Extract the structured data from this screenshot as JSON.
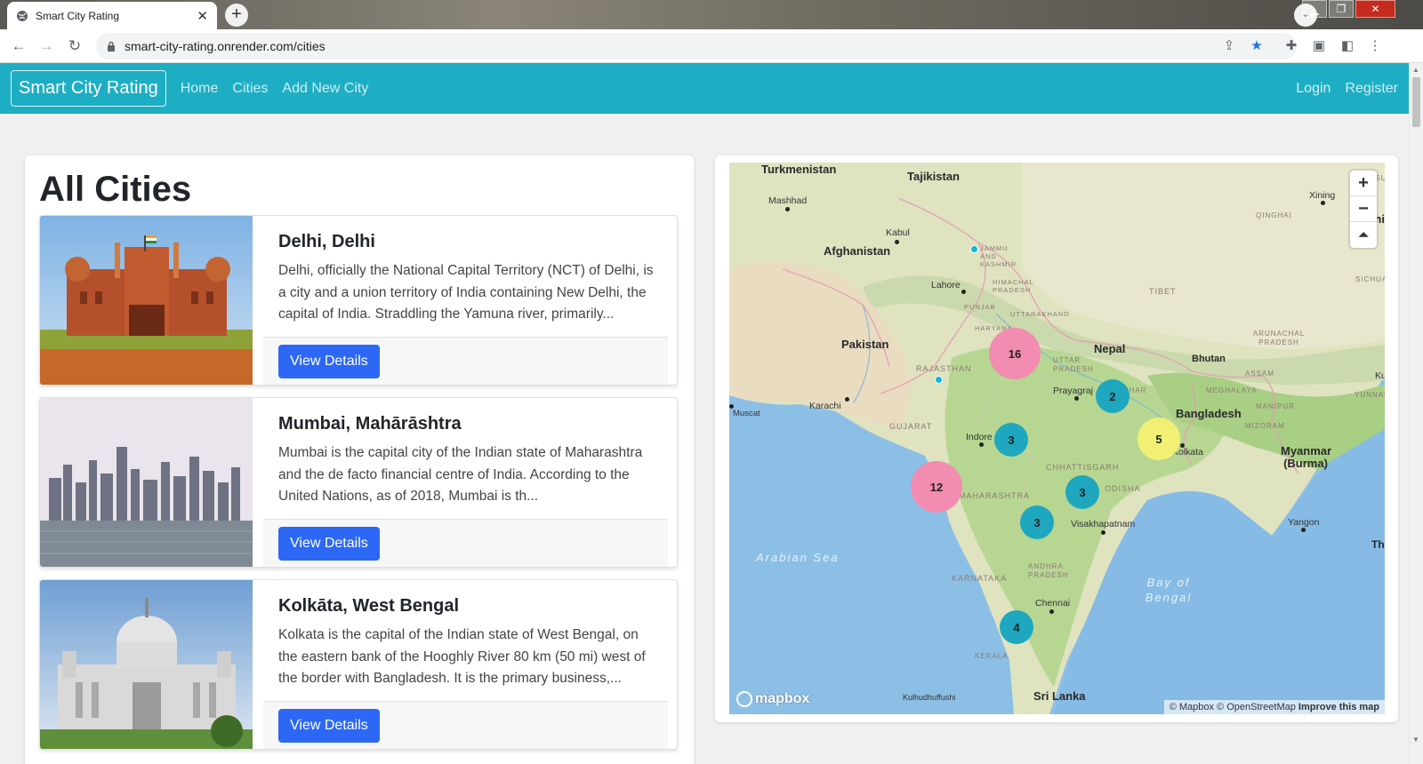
{
  "browser": {
    "tab_title": "Smart City Rating",
    "url": "smart-city-rating.onrender.com/cities"
  },
  "navbar": {
    "brand": "Smart City Rating",
    "links": [
      "Home",
      "Cities",
      "Add New City"
    ],
    "login": "Login",
    "register": "Register",
    "bg_color": "#1eaec4"
  },
  "page": {
    "title": "All Cities"
  },
  "cities": [
    {
      "title": "Delhi, Delhi",
      "description": "Delhi, officially the National Capital Territory (NCT) of Delhi, is a city and a union territory of India containing New Delhi, the capital of India. Straddling the Yamuna river, primarily...",
      "button": "View Details"
    },
    {
      "title": "Mumbai, Mahārāshtra",
      "description": "Mumbai is the capital city of the Indian state of Maharashtra and the de facto financial centre of India. According to the United Nations, as of 2018, Mumbai is th...",
      "button": "View Details"
    },
    {
      "title": "Kolkāta, West Bengal",
      "description": "Kolkata is the capital of the Indian state of West Bengal, on the eastern bank of the Hooghly River 80 km (50 mi) west of the border with Bangladesh. It is the primary business,...",
      "button": "View Details"
    }
  ],
  "map": {
    "countries": [
      "Turkmenistan",
      "Tajikistan",
      "Afghanistan",
      "Pakistan",
      "Nepal",
      "Bhutan",
      "Bangladesh",
      "Myanmar (Burma)",
      "Sri Lanka",
      "Chin",
      "Thai",
      "Ku"
    ],
    "states": [
      "JAMMU AND KASHMIR",
      "HIMACHAL PRADESH",
      "PUNJAB",
      "UTTARAKHAND",
      "HARYANA",
      "RAJASTHAN",
      "UTTAR PRADESH",
      "BIHAR",
      "GUJARAT",
      "MAHARASHTRA",
      "CHHATTISGARH",
      "ODISHA",
      "KARNATAKA",
      "ANDHRA PRADESH",
      "KERALA",
      "TIBET",
      "ARUNACHAL PRADESH",
      "ASSAM",
      "MEGHALAYA",
      "MANIPUR",
      "MIZORAM",
      "QINGHAI",
      "SICHUAN",
      "GANSU",
      "YUNNAN"
    ],
    "cities": [
      "Mashhad",
      "Kabul",
      "Lahore",
      "Karachi",
      "Muscat",
      "Prayagraj",
      "Indore",
      "Kolkata",
      "Visakhapatnam",
      "Chennai",
      "Yangon",
      "Xining",
      "Kulhudhuffushi"
    ],
    "seas": [
      "Arabian Sea",
      "Bay of Bengal"
    ],
    "clusters": [
      {
        "count": "16",
        "color": "pink"
      },
      {
        "count": "2",
        "color": "teal"
      },
      {
        "count": "3",
        "color": "teal"
      },
      {
        "count": "5",
        "color": "yellow"
      },
      {
        "count": "12",
        "color": "pink"
      },
      {
        "count": "3",
        "color": "teal"
      },
      {
        "count": "3",
        "color": "teal"
      },
      {
        "count": "4",
        "color": "teal"
      }
    ],
    "zoom_in": "+",
    "zoom_out": "−",
    "logo": "mapbox",
    "attribution": "© Mapbox © OpenStreetMap",
    "improve": "Improve this map"
  }
}
